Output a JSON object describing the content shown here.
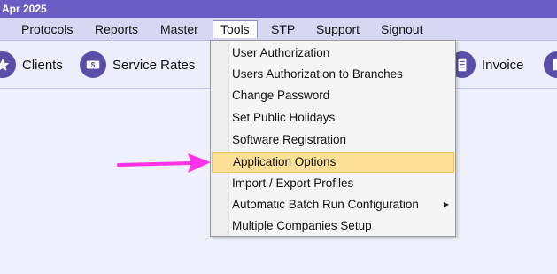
{
  "title": "Apr 2025",
  "menu": {
    "items": [
      "Protocols",
      "Reports",
      "Master",
      "Tools",
      "STP",
      "Support",
      "Signout"
    ],
    "active": "Tools"
  },
  "toolbar": {
    "clients_label": "Clients",
    "service_rates_label": "Service Rates",
    "invoice_label": "Invoice"
  },
  "tools_menu": {
    "items": [
      "User Authorization",
      "Users Authorization to Branches",
      "Change Password",
      "Set Public Holidays",
      "Software Registration",
      "Application Options",
      "Import / Export Profiles",
      "Automatic Batch Run Configuration",
      "Multiple Companies Setup"
    ],
    "highlighted": "Application Options",
    "submenu_item": "Automatic Batch Run Configuration"
  },
  "colors": {
    "titlebar": "#6a5dc4",
    "menubar": "#d6d8f3",
    "highlight": "#fddf96",
    "arrow": "#ff33e6",
    "icon": "#5a4fa8"
  },
  "icons": {
    "clients": "star-icon",
    "service_rates": "dollar-icon",
    "invoice": "document-icon"
  }
}
